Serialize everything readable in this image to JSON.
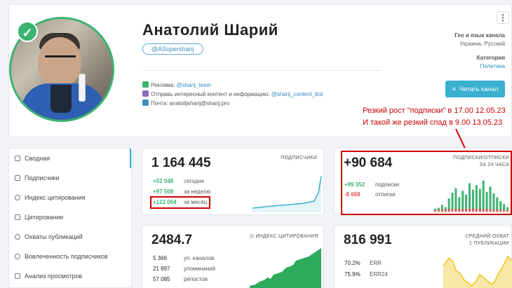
{
  "profile": {
    "name": "Анатолий Шарий",
    "handle": "@ASupersharij",
    "ads_label": "Реклама:",
    "ads_link": "@sharij_team",
    "send_label": "Отправь интересный контент и информацию:",
    "send_link": "@sharij_content_bot",
    "mail_label": "Почта:",
    "mail_value": "anatolijsharij@sharij.pro",
    "read_button": "Читать канал"
  },
  "meta": {
    "geo_label": "Гео и язык канала",
    "geo_value": "Украина, Русский",
    "category_label": "Категория",
    "category_value": "Политика"
  },
  "annotation": {
    "line1": "Резкий рост \"подписки\" в 17.00 12.05.23",
    "line2": "И такой же резкий спад в 9.00 13.05.23"
  },
  "sidebar": {
    "items": [
      {
        "label": "Сводная"
      },
      {
        "label": "Подписчики"
      },
      {
        "label": "Индекс цитирования"
      },
      {
        "label": "Цитирование"
      },
      {
        "label": "Охваты публикаций"
      },
      {
        "label": "Вовлеченность подписчиков"
      },
      {
        "label": "Анализ просмотров"
      }
    ]
  },
  "subscribers": {
    "total": "1 164 445",
    "label": "ПОДПИСЧИКИ",
    "rows": [
      {
        "value": "+52 048",
        "desc": "сегодня"
      },
      {
        "value": "+97 508",
        "desc": "за неделю"
      },
      {
        "value": "+122 064",
        "desc": "за месяц"
      }
    ]
  },
  "subs_unsubs": {
    "total": "+90 684",
    "label_line1": "ПОДПИСКИ/ОТПИСКИ",
    "label_line2": "ЗА 24 ЧАСА",
    "rows": [
      {
        "value": "+99 352",
        "desc": "подписки"
      },
      {
        "value": "-8 668",
        "desc": "отписки"
      }
    ],
    "bars_subs": [
      0.08,
      0.1,
      0.18,
      0.12,
      0.35,
      0.5,
      0.62,
      0.38,
      0.55,
      0.45,
      0.75,
      0.58,
      0.7,
      0.6,
      0.82,
      0.52,
      0.66,
      0.48,
      0.38,
      0.28,
      0.2,
      0.12
    ],
    "bars_unsubs": [
      0.04,
      0.05,
      0.06,
      0.05,
      0.07,
      0.06,
      0.08,
      0.07,
      0.06,
      0.08,
      0.07,
      0.09,
      0.07,
      0.08,
      0.06,
      0.07,
      0.06,
      0.05,
      0.06,
      0.05,
      0.04,
      0.04
    ]
  },
  "citation": {
    "total": "2484.7",
    "label": "ИНДЕКС ЦИТИРОВАНИЯ",
    "rows": [
      {
        "value": "5 366",
        "desc": "уп. каналов"
      },
      {
        "value": "21 897",
        "desc": "упоминаний"
      },
      {
        "value": "57 085",
        "desc": "репостов"
      }
    ]
  },
  "reach": {
    "total": "816 991",
    "label_line1": "СРЕДНИЙ ОХВАТ",
    "label_line2": "1 ПУБЛИКАЦИИ",
    "rows": [
      {
        "value": "70.2%",
        "desc": "ERR"
      },
      {
        "value": "75.9%",
        "desc": "ERR24"
      }
    ]
  },
  "colors": {
    "accent": "#39b1cf",
    "green": "#3cb371",
    "red": "#d9534f",
    "annotation": "#cc0000"
  }
}
